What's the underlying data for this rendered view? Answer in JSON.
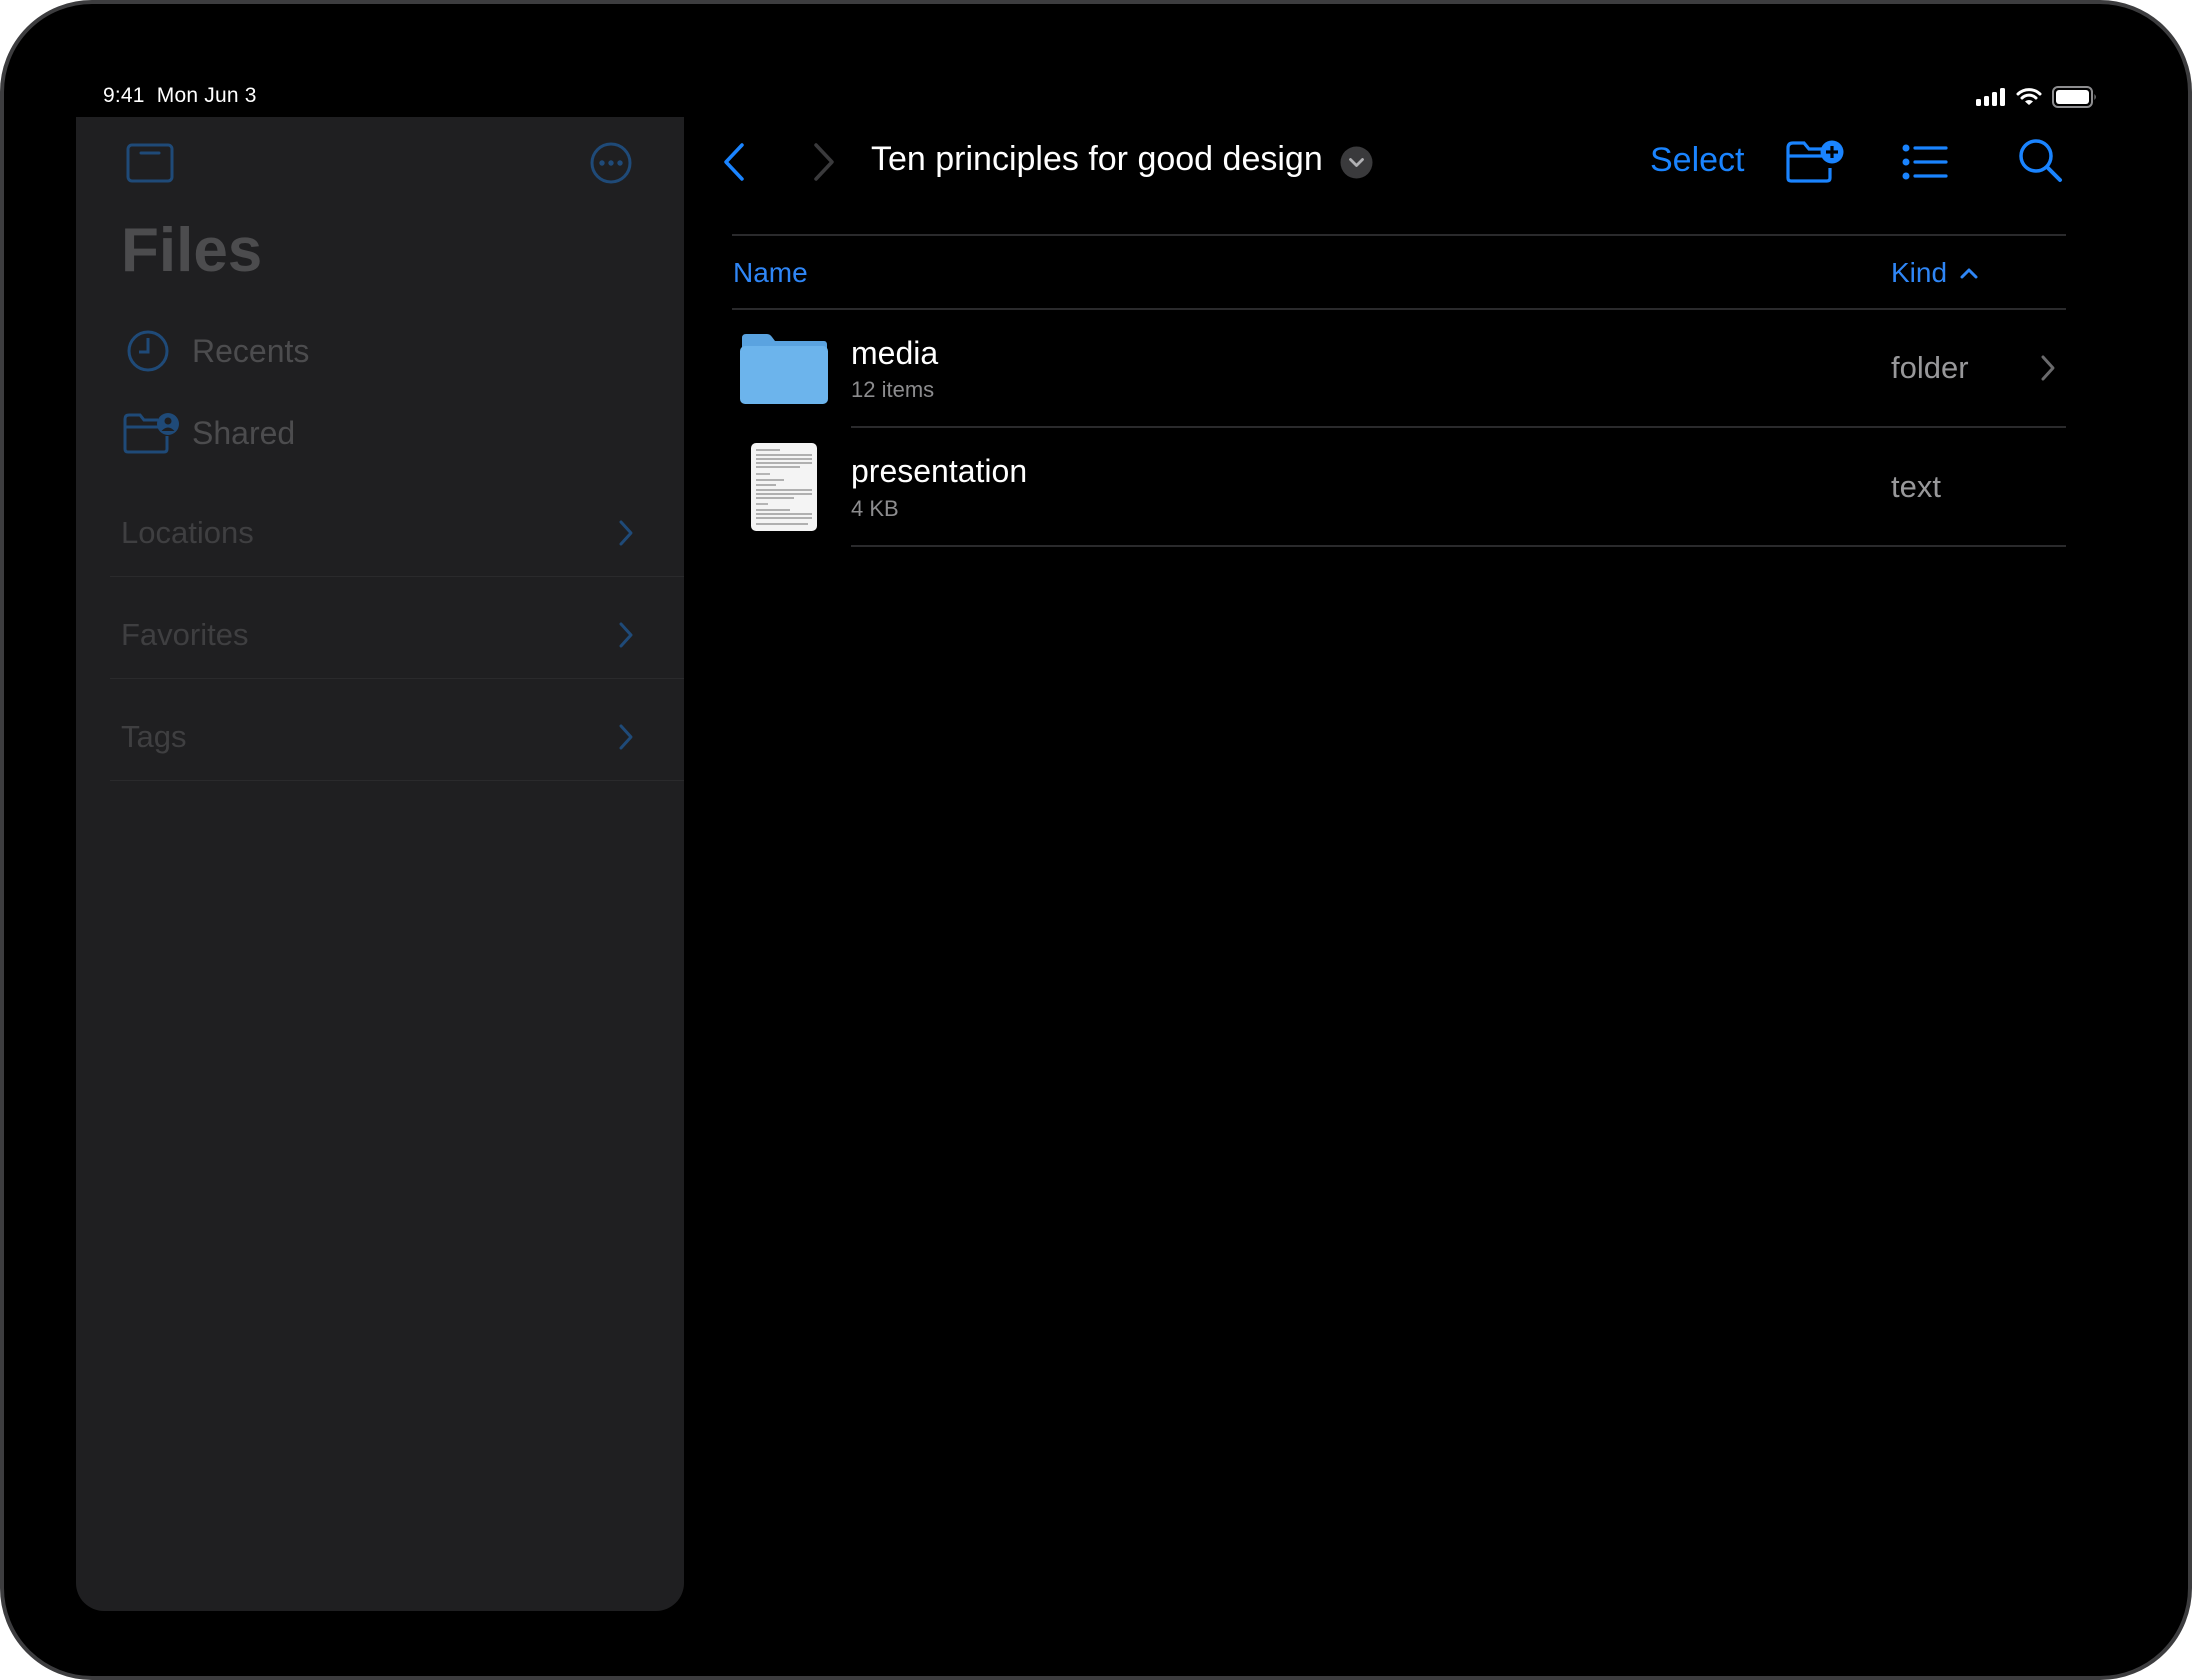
{
  "status_bar": {
    "time": "9:41",
    "date": "Mon Jun 3",
    "icons": [
      "cellular-signal-icon",
      "wifi-icon",
      "battery-icon"
    ]
  },
  "sidebar": {
    "title": "Files",
    "top_icons": [
      "sidebar-toggle-icon",
      "more-options-icon"
    ],
    "items": [
      {
        "label": "Recents",
        "icon": "clock-icon"
      },
      {
        "label": "Shared",
        "icon": "shared-folder-icon"
      }
    ],
    "sections": [
      {
        "label": "Locations"
      },
      {
        "label": "Favorites"
      },
      {
        "label": "Tags"
      }
    ]
  },
  "toolbar": {
    "back_icon": "chevron-left-icon",
    "forward_icon": "chevron-right-icon",
    "title": "Ten principles for good design",
    "title_menu_icon": "chevron-down-circle-icon",
    "select_label": "Select",
    "actions": [
      "new-folder-icon",
      "list-view-icon",
      "search-icon"
    ]
  },
  "columns": {
    "name": "Name",
    "kind": "Kind",
    "sort_direction": "ascending"
  },
  "files": [
    {
      "name": "media",
      "detail": "12 items",
      "kind": "folder",
      "icon": "folder-icon",
      "has_chevron": true
    },
    {
      "name": "presentation",
      "detail": "4 KB",
      "kind": "text",
      "icon": "document-thumbnail-icon",
      "has_chevron": false
    }
  ],
  "colors": {
    "accent": "#1a84ff",
    "background": "#000000",
    "sidebar_bg": "#1f1f21",
    "folder": "#6cb4ec"
  }
}
